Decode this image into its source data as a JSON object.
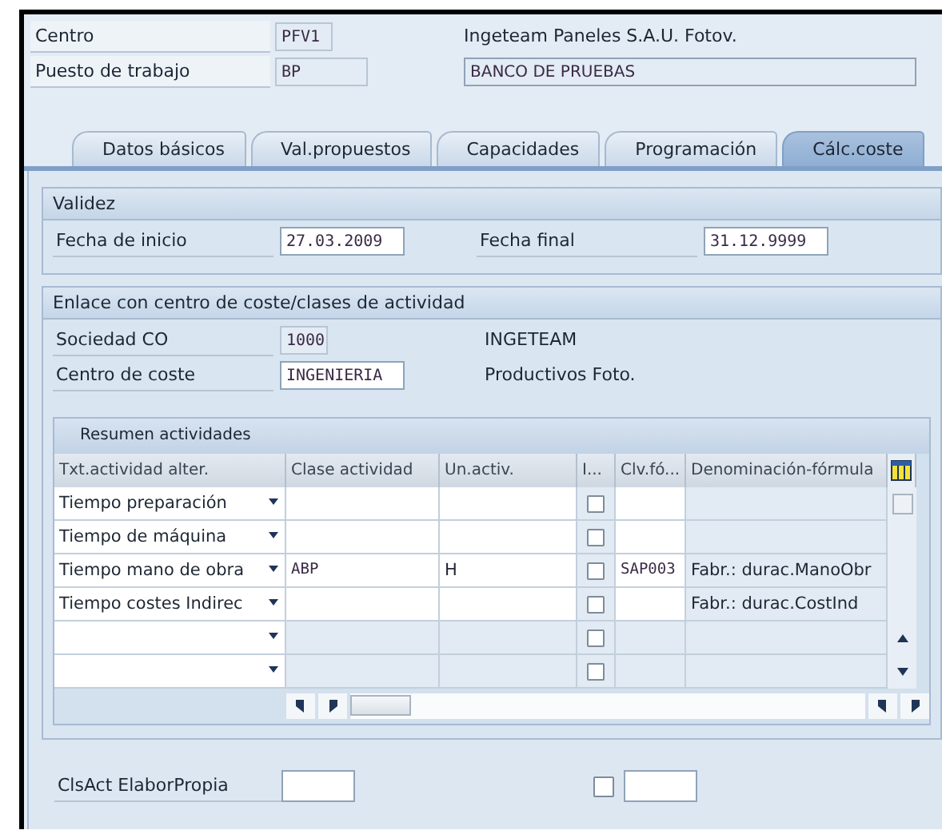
{
  "header": {
    "fields": [
      {
        "label": "Centro",
        "value": "PFV1",
        "description": "Ingeteam Paneles S.A.U. Fotov.",
        "kind": "text"
      },
      {
        "label": "Puesto de trabajo",
        "value": "BP",
        "description": "BANCO DE PRUEBAS",
        "kind": "field"
      }
    ]
  },
  "tabs": [
    {
      "label": "Datos básicos",
      "selected": false
    },
    {
      "label": "Val.propuestos",
      "selected": false
    },
    {
      "label": "Capacidades",
      "selected": false
    },
    {
      "label": "Programación",
      "selected": false
    },
    {
      "label": "Cálc.coste",
      "selected": true
    }
  ],
  "validity": {
    "title": "Validez",
    "fields": [
      {
        "label": "Fecha de inicio",
        "value": "27.03.2009"
      },
      {
        "label": "Fecha final",
        "value": "31.12.9999"
      }
    ]
  },
  "cost_link": {
    "title": "Enlace con centro de coste/clases de actividad",
    "fields": [
      {
        "label": "Sociedad CO",
        "value": "1000",
        "description": "INGETEAM"
      },
      {
        "label": "Centro de coste",
        "value": "INGENIERIA",
        "description": "Productivos Foto."
      }
    ]
  },
  "activities": {
    "title": "Resumen actividades",
    "columns": [
      "Txt.actividad alter.",
      "Clase actividad",
      "Un.activ.",
      "I...",
      "Clv.fó...",
      "Denominación-fórmula"
    ],
    "rows": [
      {
        "activity_text": "Tiempo preparación",
        "editable": true,
        "checked": false
      },
      {
        "activity_text": "Tiempo de máquina",
        "editable": true,
        "checked": false
      },
      {
        "activity_text": "Tiempo mano de obra",
        "activity_type": "ABP",
        "unit": "H",
        "editable": true,
        "checked": false,
        "formula_key": "SAP003",
        "formula_name": "Fabr.: durac.ManoObr"
      },
      {
        "activity_text": "Tiempo costes Indirec",
        "editable": true,
        "checked": false,
        "formula_name": "Fabr.: durac.CostInd"
      },
      {
        "editable": false,
        "checked": false
      },
      {
        "editable": false,
        "checked": false
      }
    ]
  },
  "own_activity": {
    "label": "ClsAct ElaborPropia",
    "checked": false
  }
}
